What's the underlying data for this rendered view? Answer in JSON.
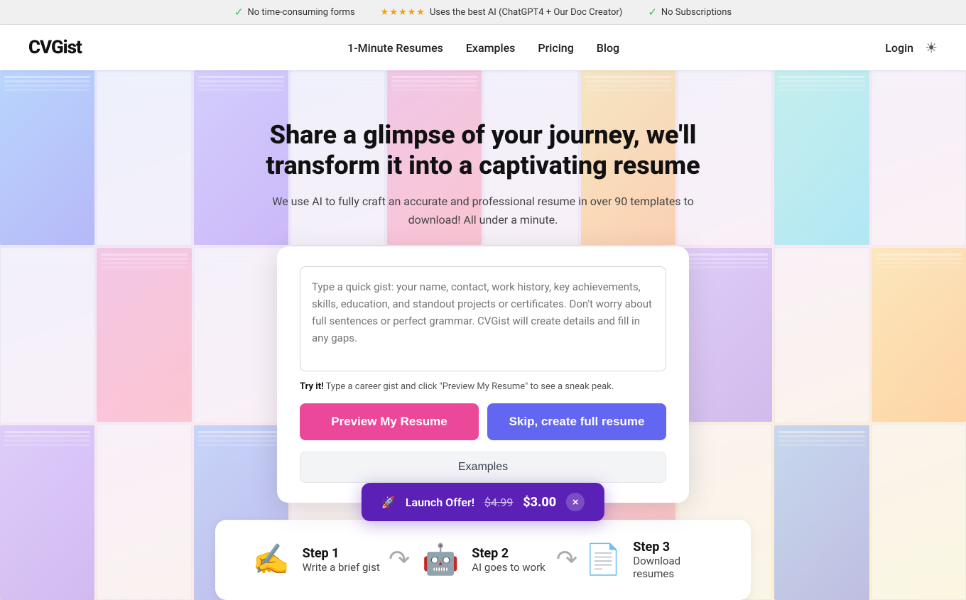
{
  "topBanner": {
    "items": [
      {
        "icon": "✓",
        "text": "No time-consuming forms"
      },
      {
        "stars": "★★★★★",
        "text": "Uses the best AI (ChatGPT4 + Our Doc Creator)"
      },
      {
        "icon": "✓",
        "text": "No Subscriptions"
      }
    ]
  },
  "header": {
    "logo": "CVGist",
    "nav": [
      {
        "label": "1-Minute Resumes",
        "href": "#"
      },
      {
        "label": "Examples",
        "href": "#"
      },
      {
        "label": "Pricing",
        "href": "#"
      },
      {
        "label": "Blog",
        "href": "#"
      }
    ],
    "login": "Login",
    "themeIcon": "☀"
  },
  "hero": {
    "title": "Share a glimpse of your journey, we'll transform it into a captivating resume",
    "subtitle": "We use AI to fully craft an accurate and professional resume in over 90 templates to download! All under a minute.",
    "textareaPlaceholder": "Type a quick gist: your name, contact, work history, key achievements, skills, education, and standout projects or certificates. Don't worry about full sentences or perfect grammar. CVGist will create details and fill in any gaps.",
    "tryHint": "Try it!",
    "tryHintText": " Type a career gist and click \"Preview My Resume\" to see a sneak peak.",
    "previewBtn": "Preview My Resume",
    "skipBtn": "Skip, create full resume",
    "examplesBtn": "Examples"
  },
  "steps": [
    {
      "icon": "✍",
      "title": "Step 1",
      "desc": "Write a brief gist"
    },
    {
      "icon": "🤖",
      "title": "Step 2",
      "desc": "AI goes to work"
    },
    {
      "icon": "📄",
      "title": "Step 3",
      "desc": "Download resumes"
    }
  ],
  "launchOffer": {
    "emoji": "🚀",
    "label": "Launch Offer!",
    "oldPrice": "$4.99",
    "newPrice": "$3.00",
    "closeIcon": "×"
  }
}
